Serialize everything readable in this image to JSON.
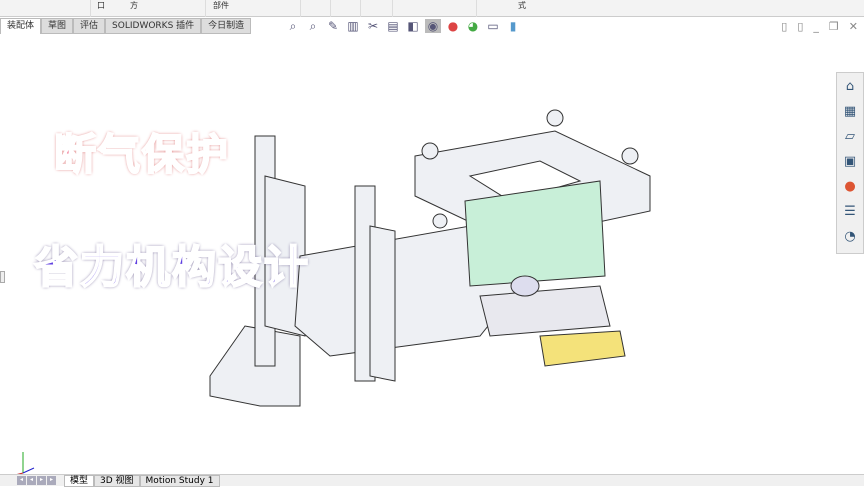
{
  "toolbar": {
    "labels": [
      "口",
      "方",
      "部件",
      "式"
    ]
  },
  "tabs": [
    {
      "label": "装配体",
      "active": true
    },
    {
      "label": "草图"
    },
    {
      "label": "评估"
    },
    {
      "label": "SOLIDWORKS 插件"
    },
    {
      "label": "今日制造"
    }
  ],
  "headsup_icons": [
    "zoom-to-fit-icon",
    "zoom-area-icon",
    "previous-view-icon",
    "section-view-icon",
    "dynamic-annotation-icon",
    "view-orientation-icon",
    "display-style-icon",
    "hide-show-icon",
    "edit-appearance-icon",
    "apply-scene-icon",
    "view-settings-icon",
    "display-pane-icon"
  ],
  "overlay": {
    "title1": "断气保护",
    "title2": "省力机构设计"
  },
  "bottom_tabs": [
    {
      "label": "模型",
      "active": true
    },
    {
      "label": "3D 视图"
    },
    {
      "label": "Motion Study 1"
    }
  ],
  "colors": {
    "title1": "#f06a8a",
    "title2": "#6040e0",
    "highlight": "#f4e27a",
    "green": "#c8efd8"
  }
}
